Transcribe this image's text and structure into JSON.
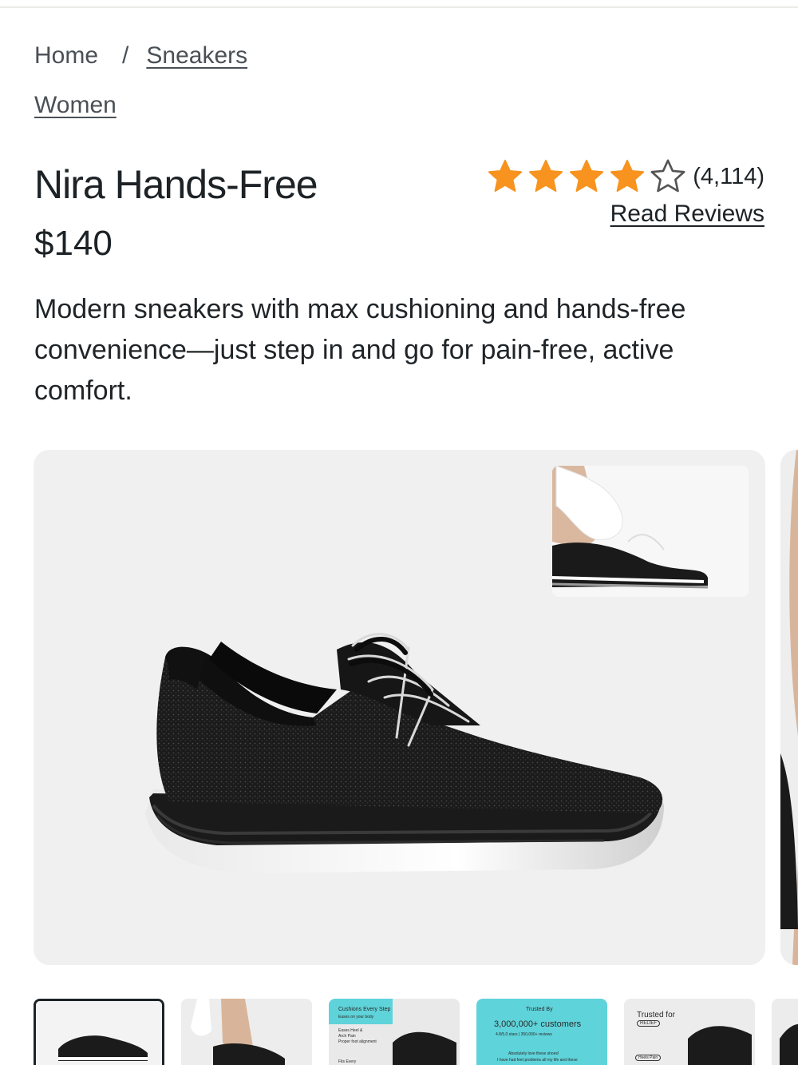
{
  "breadcrumb": {
    "home": "Home",
    "separator": "/",
    "category": "Sneakers",
    "subcategory": "Women"
  },
  "product": {
    "title": "Nira Hands-Free",
    "price": "$140",
    "rating": 4,
    "rating_max": 5,
    "review_count": "(4,114)",
    "read_reviews_label": "Read Reviews",
    "description": "Modern sneakers with max cushioning and hands-free convenience—just step in and go for pain-free, active comfort."
  },
  "thumbnails": [
    {
      "label": ""
    },
    {
      "label": ""
    },
    {
      "label": "Cushions Every Step",
      "lines": [
        "Eases on your body",
        "Eases Heel &",
        "Arch Pain",
        "Proper foot alignment",
        "Fits Every"
      ]
    },
    {
      "label": "Trusted By",
      "headline": "3,000,000+ customers",
      "sub": "4.8/5.0 stars | 350,000+ reviews",
      "quote": "Absolutely love these shoes!",
      "quote2": "I have had feet problems all my life and these"
    },
    {
      "label": "Trusted for",
      "badge": "RELIEF",
      "chip": "Heels Pain"
    }
  ],
  "colors": {
    "star": "#F7931E",
    "text": "#1C2226",
    "gallery_bg": "#F0F0F0",
    "promo_teal": "#5FD3DA"
  }
}
